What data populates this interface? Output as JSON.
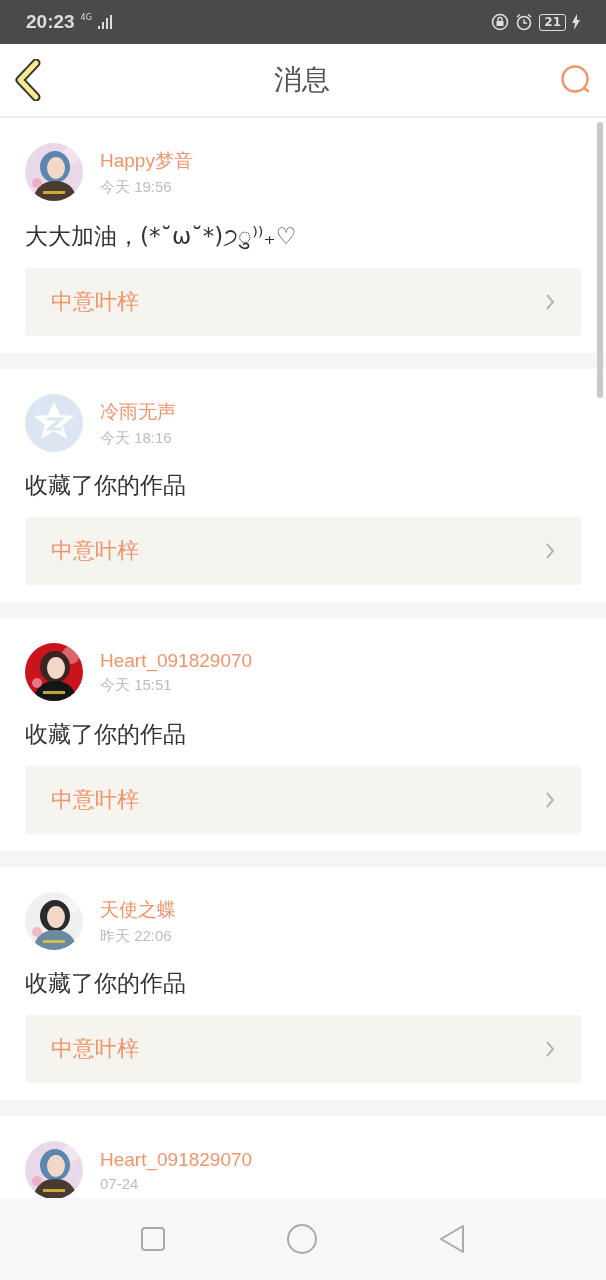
{
  "status_bar": {
    "time": "20:23",
    "network": "4G",
    "battery": "21"
  },
  "header": {
    "title": "消息"
  },
  "messages": [
    {
      "name": "Happy梦音",
      "time": "今天 19:56",
      "text": "大大加油，(*˘ω˘*)੭ु⁾⁾₊♡",
      "link": "中意叶梓"
    },
    {
      "avatar": {
        "kind": "default"
      },
      "name": "冷雨无声",
      "time": "今天 18:16",
      "text": "收藏了你的作品",
      "link": "中意叶梓"
    },
    {
      "name": "Heart_091829070",
      "time": "今天 15:51",
      "text": "收藏了你的作品",
      "link": "中意叶梓"
    },
    {
      "name": "天使之蝶",
      "time": "昨天 22:06",
      "text": "收藏了你的作品",
      "link": "中意叶梓"
    },
    {
      "name": "Heart_091829070",
      "time": "07-24"
    }
  ]
}
